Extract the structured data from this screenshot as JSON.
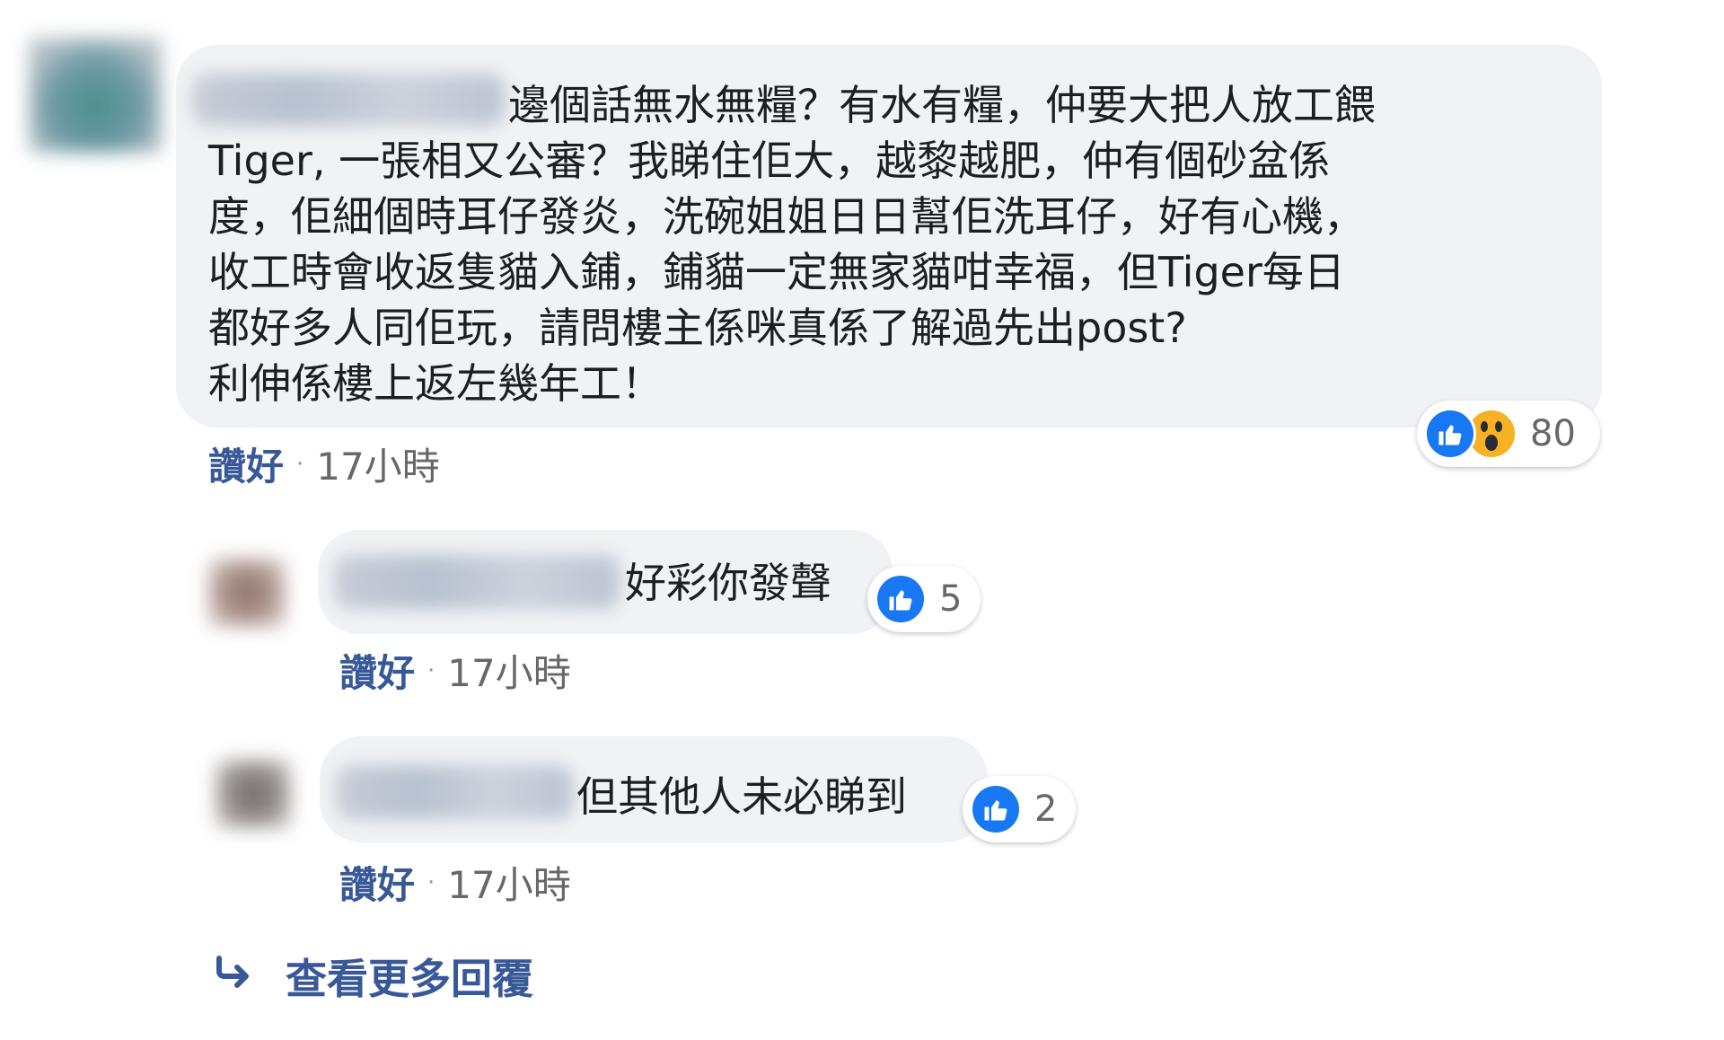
{
  "comment": {
    "text": "邊個話無水無糧？有水有糧，仲要大把人放工餵\nTiger, 一張相又公審？我睇住佢大，越黎越肥，仲有個砂盆係\n度，佢細個時耳仔發炎，洗碗姐姐日日幫佢洗耳仔，好有心機，\n收工時會收返隻貓入鋪，鋪貓一定無家貓咁幸福，但Tiger每日\n都好多人同佢玩，請問樓主係咪真係了解過先出post?\n利伸係樓上返左幾年工！",
    "reaction_count": "80",
    "like_label": "讚好",
    "separator": "·",
    "time": "17小時"
  },
  "replies": [
    {
      "text": "好彩你發聲",
      "reaction_count": "5",
      "like_label": "讚好",
      "separator": "·",
      "time": "17小時"
    },
    {
      "text": "但其他人未必睇到",
      "reaction_count": "2",
      "like_label": "讚好",
      "separator": "·",
      "time": "17小時"
    }
  ],
  "more_replies_label": "查看更多回覆",
  "icons": {
    "like": "like-icon",
    "wow": "wow-icon",
    "reply_arrow": "reply-arrow-icon"
  },
  "colors": {
    "bubble": "#f0f2f5",
    "link": "#385898",
    "meta": "#65676b",
    "like_blue": "#1877f2",
    "wow_yellow": "#f7b125"
  }
}
